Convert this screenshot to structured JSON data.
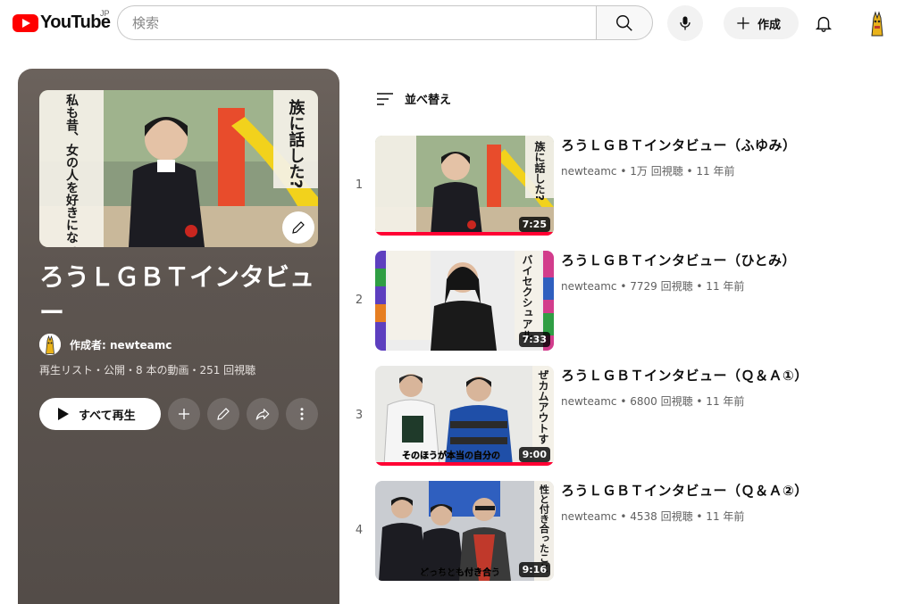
{
  "header": {
    "logo_text": "YouTube",
    "region": "JP",
    "search_placeholder": "検索",
    "create_label": "作成"
  },
  "playlist": {
    "title": "ろうＬＧＢＴインタビュー",
    "creator": "作成者: newteamc",
    "meta": "再生リスト・公開・8 本の動画・251 回視聴",
    "play_all_label": "すべて再生",
    "thumbnail_caption_right": "族に話した?",
    "thumbnail_caption_left": "私も昔、女の人を好きになった経験があったので、"
  },
  "sort": {
    "label": "並べ替え"
  },
  "videos": [
    {
      "index": "1",
      "title": "ろうＬＧＢＴインタビュー（ふゆみ）",
      "channel": "newteamc",
      "stats": "1万 回視聴 • 11 年前",
      "duration": "7:25",
      "caption": "族に話した?",
      "accent": "#f2d21c"
    },
    {
      "index": "2",
      "title": "ろうＬＧＢＴインタビュー（ひとみ）",
      "channel": "newteamc",
      "stats": "7729 回視聴 • 11 年前",
      "duration": "7:33",
      "caption": "バイセクシュアル",
      "accent": "#d23c8c"
    },
    {
      "index": "3",
      "title": "ろうＬＧＢＴインタビュー（Ｑ＆Ａ①）",
      "channel": "newteamc",
      "stats": "6800 回視聴 • 11 年前",
      "duration": "9:00",
      "caption": "ぜカムアウトす",
      "subtitle": "そのほうが本当の自分の",
      "accent": "#1f4fa8"
    },
    {
      "index": "4",
      "title": "ろうＬＧＢＴインタビュー（Ｑ＆Ａ②）",
      "channel": "newteamc",
      "stats": "4538 回視聴 • 11 年前",
      "duration": "9:16",
      "caption": "性と付き合ったこと",
      "subtitle": "どっちとも付き合う",
      "accent": "#c0392b"
    }
  ],
  "separator": " • "
}
